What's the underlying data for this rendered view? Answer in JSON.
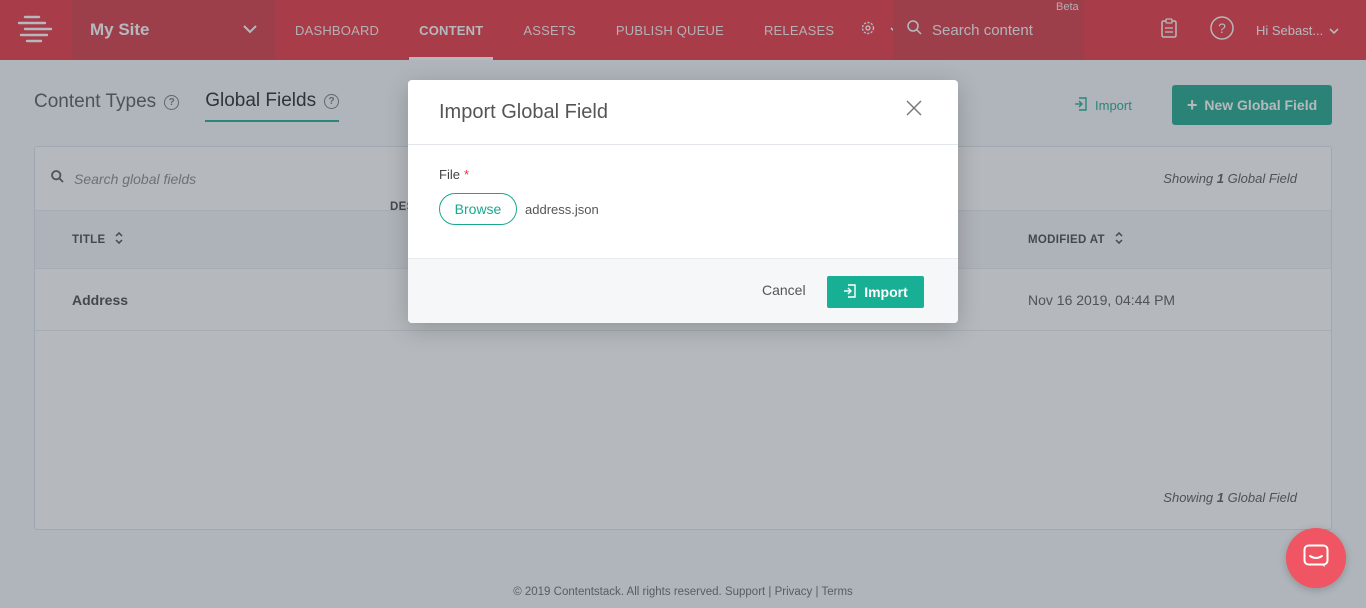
{
  "header": {
    "site_name": "My Site",
    "nav": [
      "DASHBOARD",
      "CONTENT",
      "ASSETS",
      "PUBLISH QUEUE",
      "RELEASES"
    ],
    "active_nav": "CONTENT",
    "search_placeholder": "Search content",
    "beta_label": "Beta",
    "greeting": "Hi  Sebast..."
  },
  "page": {
    "tabs": [
      "Content Types",
      "Global Fields"
    ],
    "active_tab": "Global Fields",
    "import_label": "Import",
    "new_button": "New Global Field",
    "search_placeholder": "Search global fields",
    "showing_prefix": "Showing ",
    "showing_count": "1",
    "showing_suffix": " Global Field",
    "columns": {
      "title": "TITLE",
      "description": "DES",
      "modified": "MODIFIED AT"
    },
    "rows": [
      {
        "title": "Address",
        "modified": "Nov 16 2019, 04:44 PM"
      }
    ]
  },
  "modal": {
    "title": "Import Global Field",
    "field_label": "File",
    "required_mark": "*",
    "browse_label": "Browse",
    "file_name": "address.json",
    "cancel_label": "Cancel",
    "import_label": "Import"
  },
  "footer": {
    "text": "© 2019 Contentstack. All rights reserved. Support | Privacy | Terms"
  },
  "colors": {
    "brand_red": "#ea2f3d",
    "accent_green": "#18a589"
  }
}
